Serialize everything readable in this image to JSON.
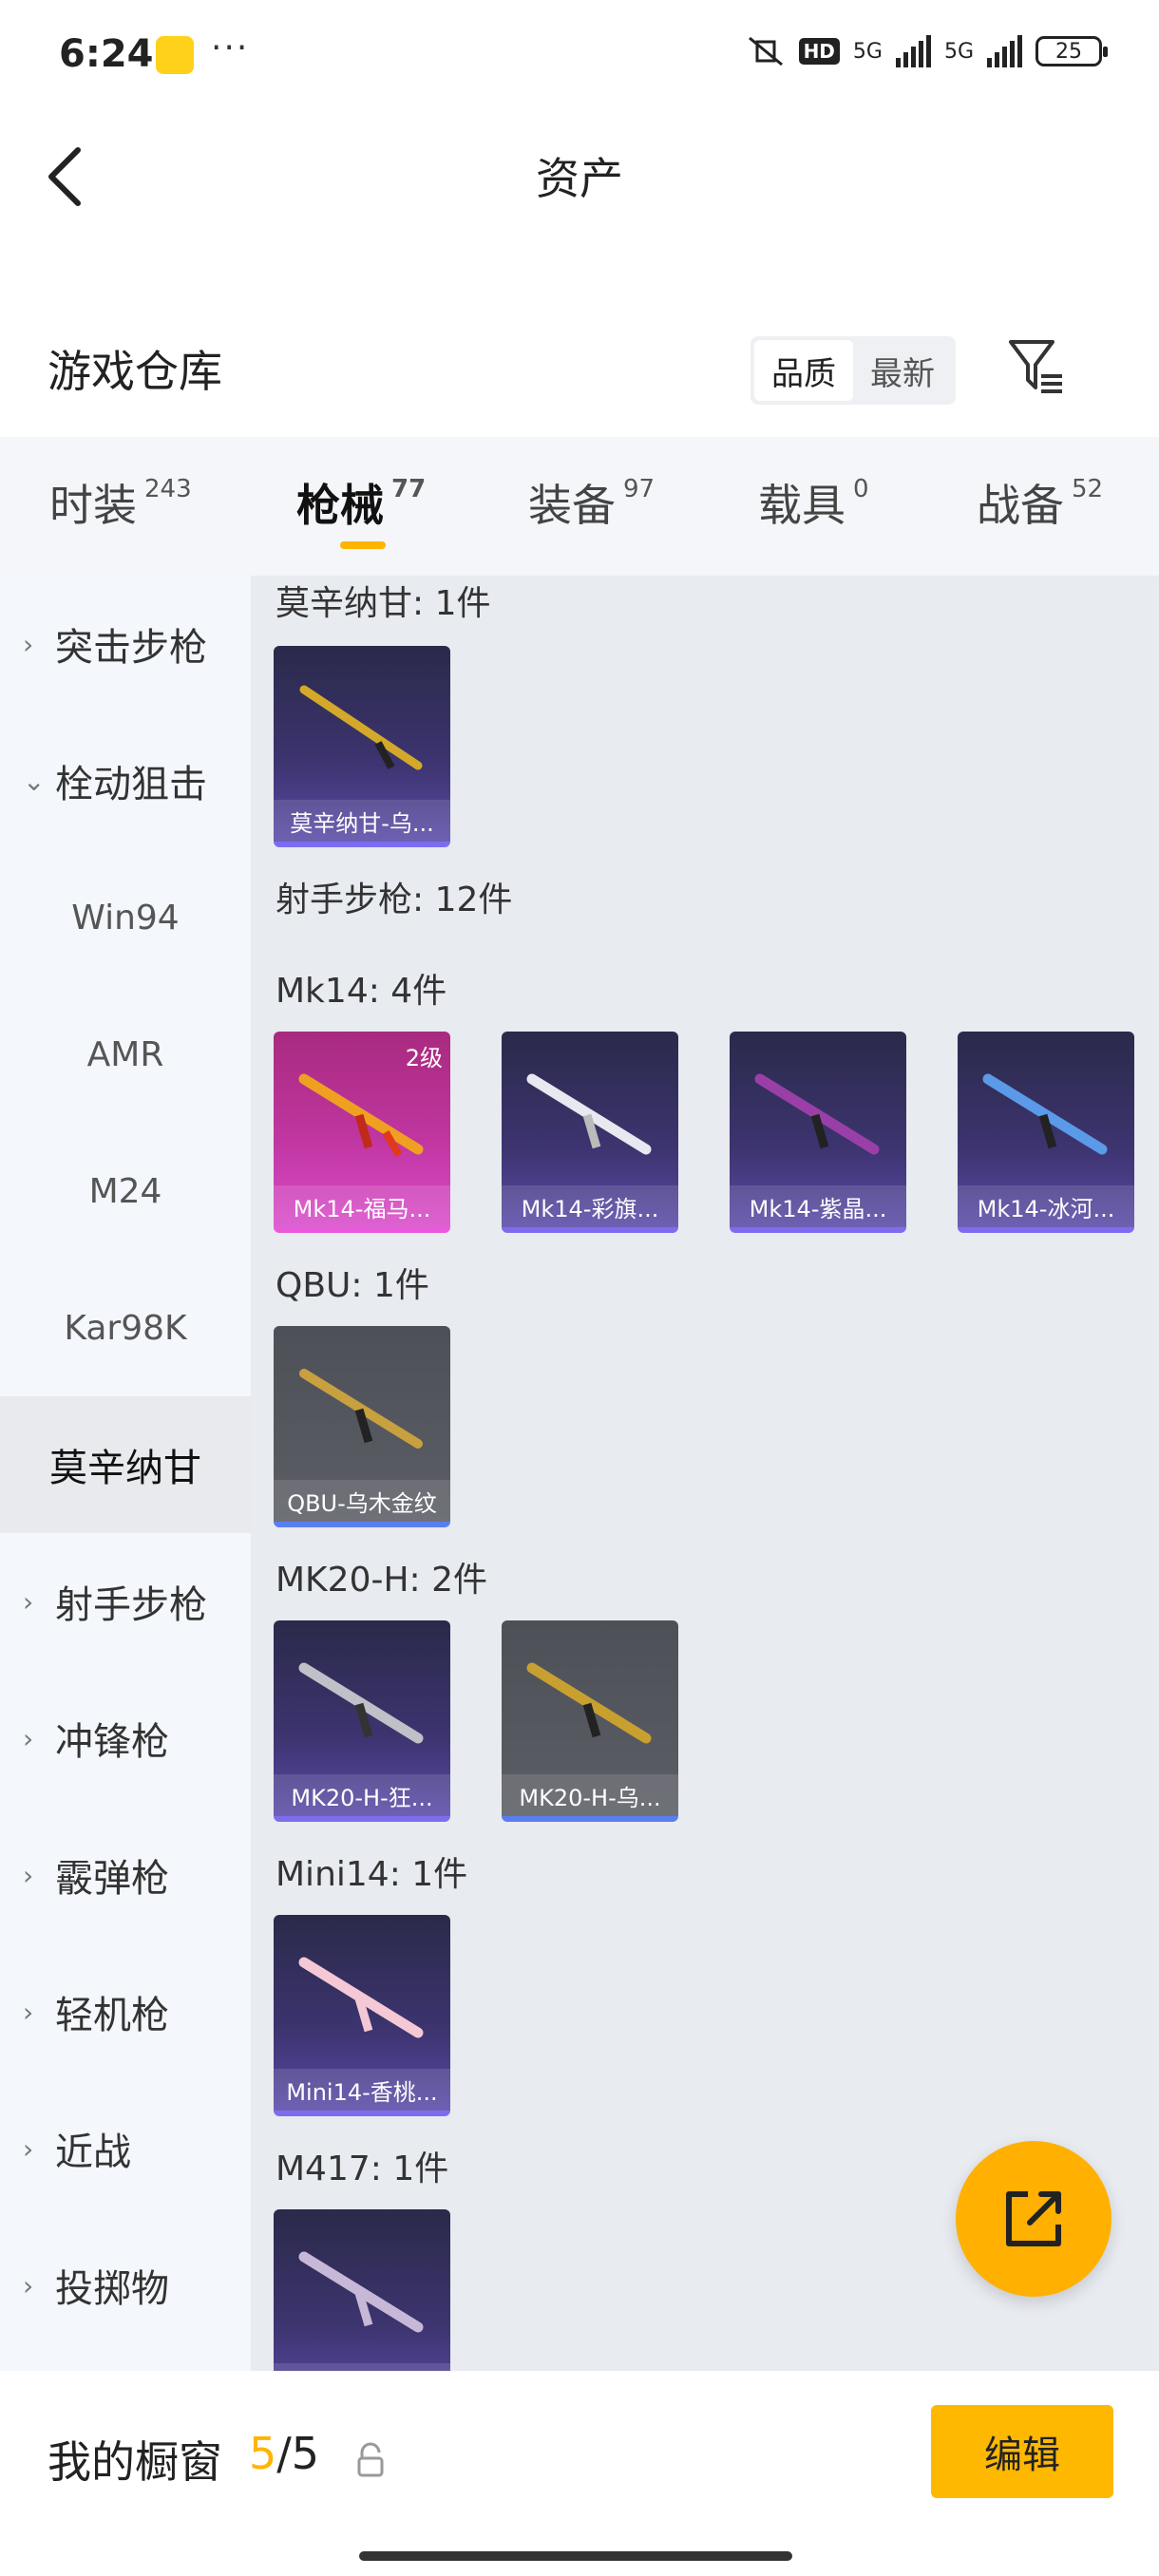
{
  "status": {
    "time": "6:24",
    "dots": "···",
    "hd": "HD",
    "net1": "5G",
    "net2": "5G",
    "battery": "25"
  },
  "header": {
    "title": "资产"
  },
  "warehouse": {
    "title": "游戏仓库",
    "sort_options": [
      "品质",
      "最新"
    ],
    "sort_selected": "品质"
  },
  "tabs": [
    {
      "label": "时装",
      "count": "243"
    },
    {
      "label": "枪械",
      "count": "77",
      "active": true
    },
    {
      "label": "装备",
      "count": "97"
    },
    {
      "label": "载具",
      "count": "0"
    },
    {
      "label": "战备",
      "count": "52"
    }
  ],
  "sidebar": {
    "items": [
      {
        "label": "突击步枪",
        "chev": "›"
      },
      {
        "label": "栓动狙击",
        "chev": "⌄"
      },
      {
        "label": "Win94"
      },
      {
        "label": "AMR"
      },
      {
        "label": "M24"
      },
      {
        "label": "Kar98K"
      },
      {
        "label": "莫辛纳甘"
      },
      {
        "label": "射手步枪",
        "chev": "›"
      },
      {
        "label": "冲锋枪",
        "chev": "›"
      },
      {
        "label": "霰弹枪",
        "chev": "›"
      },
      {
        "label": "轻机枪",
        "chev": "›"
      },
      {
        "label": "近战",
        "chev": "›"
      },
      {
        "label": "投掷物",
        "chev": "›"
      }
    ]
  },
  "groups": [
    {
      "title": "莫辛纳甘: 1件"
    },
    {
      "title": "射手步枪: 12件"
    },
    {
      "title": "Mk14: 4件"
    },
    {
      "title": "QBU: 1件"
    },
    {
      "title": "MK20-H: 2件"
    },
    {
      "title": "Mini14: 1件"
    },
    {
      "title": "M417: 1件"
    }
  ],
  "cards": [
    {
      "name": "莫辛纳甘-乌...",
      "tier": "purple"
    },
    {
      "name": "Mk14-福马...",
      "tier": "gold",
      "level": "2级"
    },
    {
      "name": "Mk14-彩旗...",
      "tier": "purple"
    },
    {
      "name": "Mk14-紫晶...",
      "tier": "purple"
    },
    {
      "name": "Mk14-冰河...",
      "tier": "purple"
    },
    {
      "name": "QBU-乌木金纹",
      "tier": "gray"
    },
    {
      "name": "MK20-H-狂...",
      "tier": "purple"
    },
    {
      "name": "MK20-H-乌...",
      "tier": "gray"
    },
    {
      "name": "Mini14-香桃...",
      "tier": "purple"
    },
    {
      "name": "",
      "tier": "purple"
    }
  ],
  "bottom": {
    "label": "我的橱窗",
    "current": "5",
    "sep_total": "/5",
    "edit": "编辑"
  },
  "colors": {
    "accent": "#ffb400",
    "sidebar_bg": "#f4f7fb",
    "grid_bg": "#e8ebf0"
  }
}
